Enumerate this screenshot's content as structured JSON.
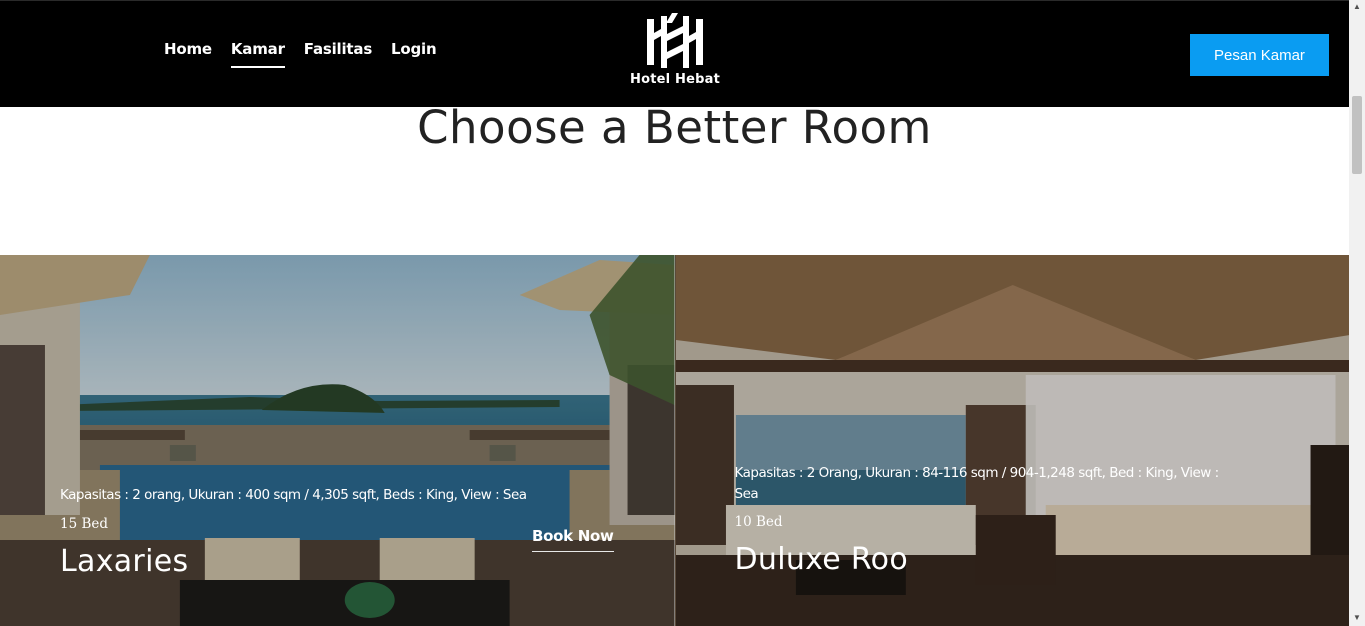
{
  "nav": {
    "links": [
      {
        "label": "Home",
        "active": false
      },
      {
        "label": "Kamar",
        "active": true
      },
      {
        "label": "Fasilitas",
        "active": false
      },
      {
        "label": "Login",
        "active": false
      }
    ],
    "brand": "Hotel Hebat",
    "cta": "Pesan Kamar"
  },
  "page": {
    "heading": "Choose a Better Room"
  },
  "rooms": [
    {
      "description": "Kapasitas : 2 orang, Ukuran : 400 sqm / 4,305 sqft, Beds : King, View : Sea",
      "beds": "15 Bed",
      "name": "Laxaries",
      "action": "Book Now"
    },
    {
      "description": "Kapasitas : 2 Orang, Ukuran : 84-116 sqm / 904-1,248 sqft, Bed : King, View : Sea",
      "beds": "10 Bed",
      "name": "Duluxe Roo"
    }
  ],
  "colors": {
    "nav_bg": "#000000",
    "cta_bg": "#0a9cf2",
    "heading": "#222222"
  },
  "icons": {
    "logo": "hotel-hebat-logo-icon"
  }
}
